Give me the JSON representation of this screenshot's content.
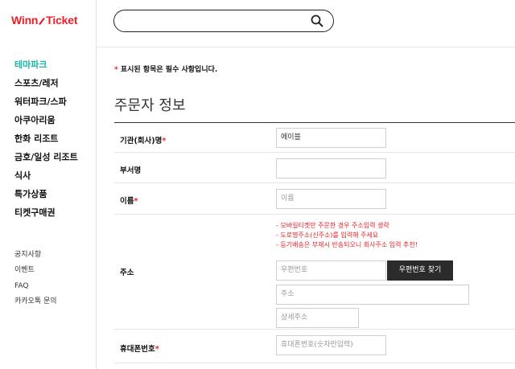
{
  "brand": {
    "logo_left": "Winn",
    "logo_right": "Ticket",
    "accent": "#e8202a",
    "active_color": "#18b5a8"
  },
  "search": {
    "placeholder": "",
    "icon": "search-icon"
  },
  "sidebar": {
    "items": [
      {
        "label": "테마파크",
        "active": true
      },
      {
        "label": "스포츠/레저",
        "active": false
      },
      {
        "label": "워터파크/스파",
        "active": false
      },
      {
        "label": "아쿠아리움",
        "active": false
      },
      {
        "label": "한화 리조트",
        "active": false
      },
      {
        "label": "금호/일성 리조트",
        "active": false
      },
      {
        "label": "식사",
        "active": false
      },
      {
        "label": "특가상품",
        "active": false
      },
      {
        "label": "티켓구매권",
        "active": false
      }
    ],
    "links": [
      "공지사항",
      "이벤트",
      "FAQ",
      "카카오톡 문의"
    ]
  },
  "main": {
    "required_star": "*",
    "required_note": " 표시된 항목은 필수 사항입니다.",
    "section_title": "주문자 정보",
    "form": {
      "org_label": "기관(회사)명",
      "org_value": "에이블",
      "dept_label": "부서명",
      "dept_value": "",
      "name_label": "이름",
      "name_placeholder": "이름",
      "address_label": "주소",
      "address_notes": [
        "- 모바일티켓만 주문한 경우 주소입력 생략",
        "- 도로명주소(신주소)를 입력해 주세요",
        "- 등기배송은 부재시 반송되오니 회사주소 입력 추천!"
      ],
      "zip_placeholder": "우편번호",
      "zip_button": "우편번호 찾기",
      "address_placeholder": "주소",
      "detail_placeholder": "상세주소",
      "phone_label": "휴대폰번호",
      "phone_placeholder": "휴대폰번호(숫자만입력)",
      "required_mark": "*"
    }
  }
}
